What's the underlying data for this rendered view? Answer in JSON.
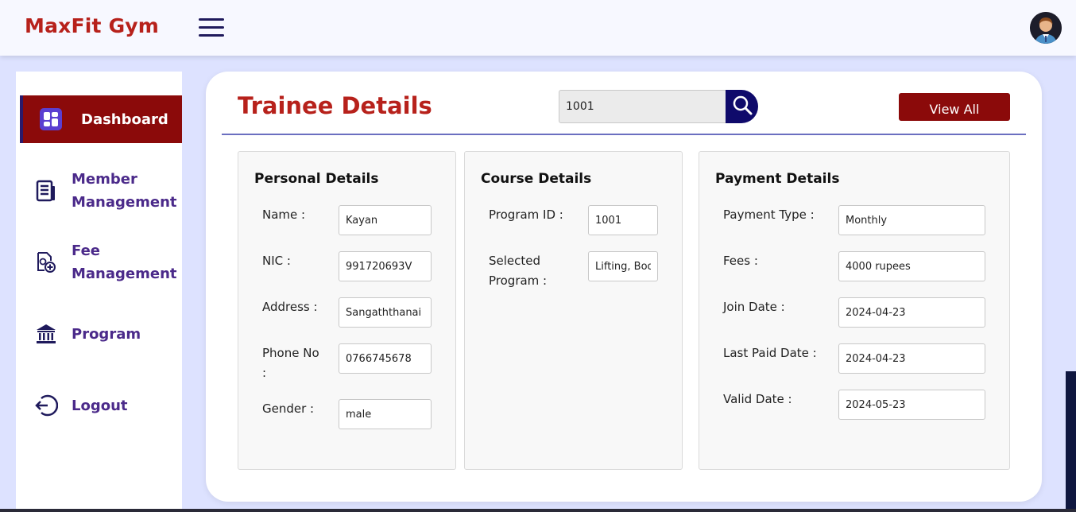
{
  "header": {
    "brand": "MaxFit Gym",
    "menu_icon": "hamburger-icon",
    "avatar_icon": "user-avatar-icon"
  },
  "sidebar": {
    "items": [
      {
        "label": "Dashboard",
        "icon": "dashboard-icon",
        "active": true
      },
      {
        "label_line1": "Member",
        "label_line2": "Management",
        "icon": "document-list-icon"
      },
      {
        "label_line1": "Fee",
        "label_line2": "Management",
        "icon": "fee-add-icon"
      },
      {
        "label": "Program",
        "icon": "bank-building-icon"
      },
      {
        "label": "Logout",
        "icon": "logout-icon"
      }
    ]
  },
  "main": {
    "title": "Trainee Details",
    "search": {
      "value": "1001",
      "icon": "search-icon"
    },
    "view_all_label": "View All",
    "personal": {
      "title": "Personal Details",
      "name_label": "Name :",
      "name_value": "Kayan",
      "nic_label": "NIC :",
      "nic_value": "991720693V",
      "address_label": "Address :",
      "address_value": "Sangaththanai",
      "phone_label_line1": "Phone No",
      "phone_label_line2": ":",
      "phone_value": "0766745678",
      "gender_label": "Gender :",
      "gender_value": "male"
    },
    "course": {
      "title": "Course Details",
      "program_id_label": "Program ID :",
      "program_id_value": "1001",
      "selected_label_line1": "Selected",
      "selected_label_line2": "Program :",
      "selected_value": "Lifting, Bod"
    },
    "payment": {
      "title": "Payment Details",
      "type_label": "Payment Type :",
      "type_value": "Monthly",
      "fees_label": "Fees :",
      "fees_value": "4000 rupees",
      "join_label": "Join Date :",
      "join_value": "2024-04-23",
      "last_paid_label": "Last Paid Date :",
      "last_paid_value": "2024-04-23",
      "valid_label": "Valid Date :",
      "valid_value": "2024-05-23"
    }
  },
  "colors": {
    "brand_red": "#b7211b",
    "active_nav": "#8b0a0a",
    "nav_text": "#4b2a8a",
    "search_button": "#0f0a6b",
    "page_bg": "#dde2ff"
  }
}
